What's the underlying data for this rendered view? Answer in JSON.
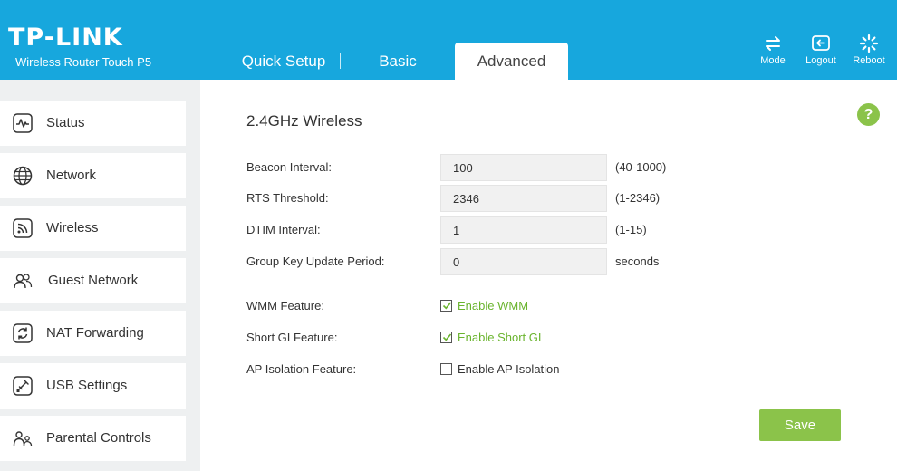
{
  "brand": {
    "logo": "TP-LINK",
    "subtitle": "Wireless Router Touch P5"
  },
  "tabs": [
    {
      "label": "Quick Setup",
      "active": false
    },
    {
      "label": "Basic",
      "active": false
    },
    {
      "label": "Advanced",
      "active": true
    }
  ],
  "header_buttons": {
    "mode": {
      "label": "Mode",
      "icon": "mode-arrows-icon"
    },
    "logout": {
      "label": "Logout",
      "icon": "logout-icon"
    },
    "reboot": {
      "label": "Reboot",
      "icon": "reboot-icon"
    }
  },
  "sidebar": {
    "items": [
      {
        "label": "Status",
        "icon": "status-pulse-icon"
      },
      {
        "label": "Network",
        "icon": "globe-icon"
      },
      {
        "label": "Wireless",
        "icon": "wifi-icon"
      },
      {
        "label": "Guest Network",
        "icon": "guest-users-icon"
      },
      {
        "label": "NAT Forwarding",
        "icon": "nat-refresh-icon"
      },
      {
        "label": "USB Settings",
        "icon": "usb-icon"
      },
      {
        "label": "Parental Controls",
        "icon": "parental-icon"
      }
    ]
  },
  "help": {
    "label": "?"
  },
  "section": {
    "title": "2.4GHz Wireless",
    "fields": [
      {
        "label": "Beacon Interval:",
        "value": "100",
        "hint": "(40-1000)"
      },
      {
        "label": "RTS Threshold:",
        "value": "2346",
        "hint": "(1-2346)"
      },
      {
        "label": "DTIM Interval:",
        "value": "1",
        "hint": "(1-15)"
      },
      {
        "label": "Group Key Update Period:",
        "value": "0",
        "hint": "seconds"
      }
    ],
    "checkboxes": [
      {
        "label": "WMM Feature:",
        "option": "Enable WMM",
        "checked": true
      },
      {
        "label": "Short GI Feature:",
        "option": "Enable Short GI",
        "checked": true
      },
      {
        "label": "AP Isolation Feature:",
        "option": "Enable AP Isolation",
        "checked": false
      }
    ]
  },
  "save_label": "Save",
  "colors": {
    "header_blue": "#17a7dd",
    "accent_green": "#8bc34a",
    "checkbox_green": "#6ab42e"
  }
}
